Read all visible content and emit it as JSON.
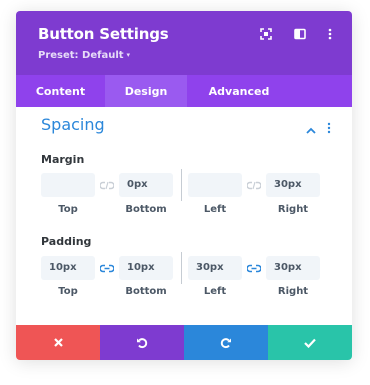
{
  "header": {
    "title": "Button Settings",
    "preset_label": "Preset: Default",
    "preset_caret": "▾"
  },
  "tabs": [
    {
      "label": "Content",
      "active": false
    },
    {
      "label": "Design",
      "active": true
    },
    {
      "label": "Advanced",
      "active": false
    }
  ],
  "section": {
    "title": "Spacing"
  },
  "margin": {
    "label": "Margin",
    "fields": [
      {
        "value": "",
        "caption": "Top"
      },
      {
        "value": "0px",
        "caption": "Bottom"
      },
      {
        "value": "",
        "caption": "Left"
      },
      {
        "value": "30px",
        "caption": "Right"
      }
    ],
    "linked": false
  },
  "padding": {
    "label": "Padding",
    "fields": [
      {
        "value": "10px",
        "caption": "Top"
      },
      {
        "value": "10px",
        "caption": "Bottom"
      },
      {
        "value": "30px",
        "caption": "Left"
      },
      {
        "value": "30px",
        "caption": "Right"
      }
    ],
    "linked": true
  },
  "colors": {
    "header": "#7e3bd0",
    "tabs": "#8f42ec",
    "accent": "#2b87da",
    "cancel": "#ef5555",
    "undo": "#7e3bd0",
    "redo": "#2b87da",
    "save": "#29c4a9"
  },
  "icons": {
    "expand": "expand-icon",
    "split": "split-view-icon",
    "more": "more-vertical-icon",
    "collapse": "chevron-up-icon",
    "link_off": "link-off-icon",
    "link_on": "link-icon",
    "cancel": "close-icon",
    "undo": "undo-icon",
    "redo": "redo-icon",
    "save": "check-icon"
  }
}
